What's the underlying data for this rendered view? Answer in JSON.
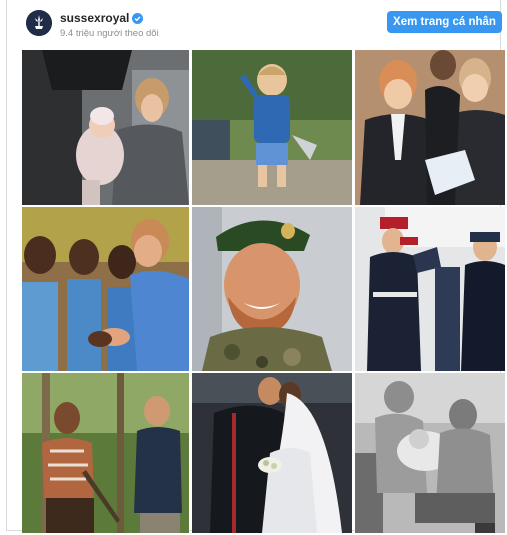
{
  "header": {
    "username": "sussexroyal",
    "followers": "9.4 triệu người theo dõi",
    "profile_button": "Xem trang cá nhân",
    "avatar_icon": "royal-crest-icon",
    "verified_icon": "verified-badge-icon"
  },
  "colors": {
    "accent": "#3897f0",
    "text": "#262626",
    "muted": "#8e8e8e",
    "border": "#dbdbdb"
  }
}
